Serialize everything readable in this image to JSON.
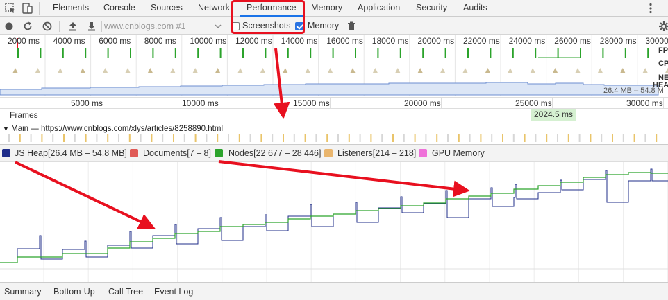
{
  "tabs": [
    {
      "label": "Elements"
    },
    {
      "label": "Console"
    },
    {
      "label": "Sources"
    },
    {
      "label": "Network"
    },
    {
      "label": "Performance"
    },
    {
      "label": "Memory"
    },
    {
      "label": "Application"
    },
    {
      "label": "Security"
    },
    {
      "label": "Audits"
    }
  ],
  "active_tab": "Performance",
  "toolbar": {
    "recording_select": "www.cnblogs.com #1",
    "screenshots_label": "Screenshots",
    "screenshots_checked": false,
    "memory_label": "Memory",
    "memory_checked": true
  },
  "overview": {
    "ticks": [
      "2000 ms",
      "4000 ms",
      "6000 ms",
      "8000 ms",
      "10000 ms",
      "12000 ms",
      "14000 ms",
      "16000 ms",
      "18000 ms",
      "20000 ms",
      "22000 ms",
      "24000 ms",
      "26000 ms",
      "28000 ms",
      "30000 ms"
    ],
    "side_labels": {
      "fps": "FP",
      "cpu": "CP",
      "net": "NE",
      "heap": "HEA"
    },
    "heap_readout": "26.4 MB – 54.8 M"
  },
  "timeline": {
    "ticks": [
      "5000 ms",
      "10000 ms",
      "15000 ms",
      "20000 ms",
      "25000 ms",
      "30000 ms"
    ],
    "frames_label": "Frames",
    "frame_time": "2024.5 ms",
    "main_label": "Main — https://www.cnblogs.com/xlys/articles/8258890.html"
  },
  "legend": [
    {
      "label": "JS Heap[26.4 MB – 54.8 MB]",
      "checked": true,
      "color": "#1f2d8a"
    },
    {
      "label": "Documents[7 – 8]",
      "checked": false,
      "color": "#e05a56"
    },
    {
      "label": "Nodes[22 677 – 28 446]",
      "checked": true,
      "color": "#2ba32b"
    },
    {
      "label": "Listeners[214 – 218]",
      "checked": false,
      "color": "#e9b56d"
    },
    {
      "label": "GPU Memory",
      "checked": false,
      "color": "#ef71d9"
    }
  ],
  "bottom_tabs": [
    {
      "label": "Summary"
    },
    {
      "label": "Bottom-Up"
    },
    {
      "label": "Call Tree"
    },
    {
      "label": "Event Log"
    }
  ],
  "colors": {
    "accent": "#1a73e8",
    "highlight": "#e8101f",
    "heap_line": "#1f2d8a",
    "nodes_line": "#2ba32b",
    "fps_green": "#2ba32b"
  }
}
